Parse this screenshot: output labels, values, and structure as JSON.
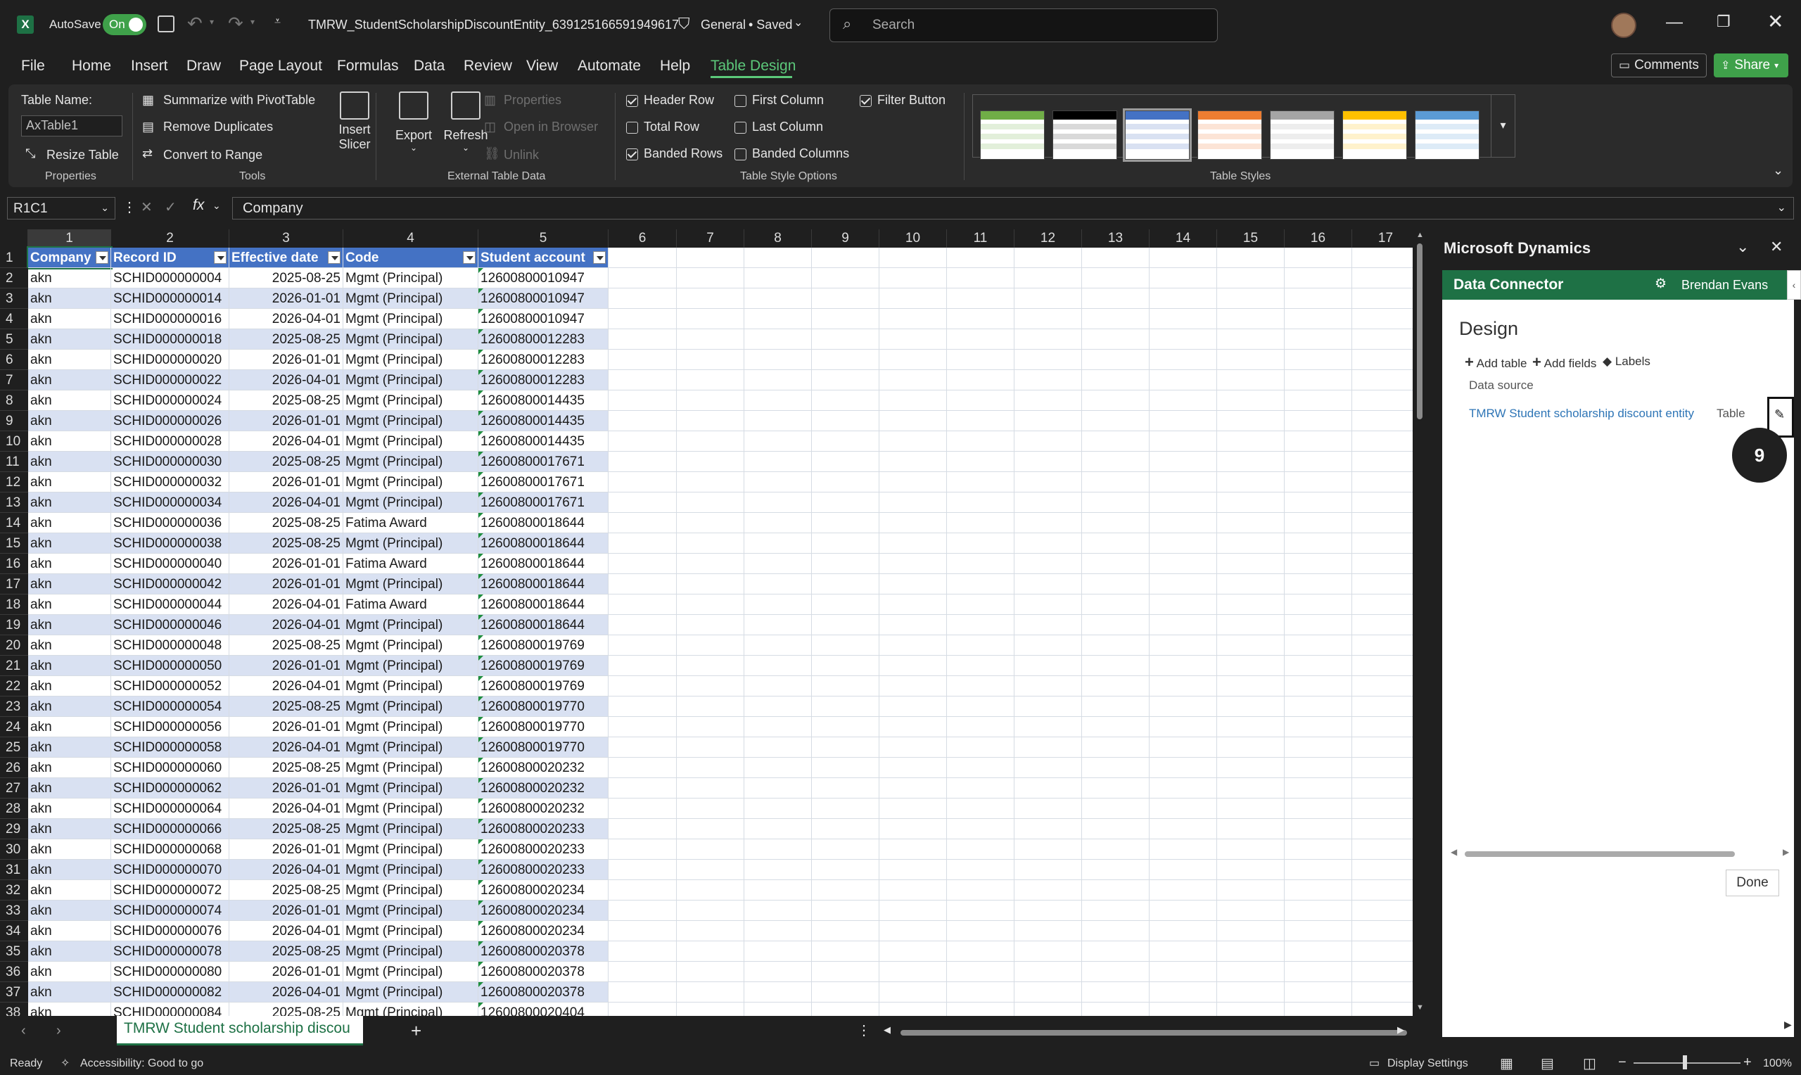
{
  "titlebar": {
    "autosave_label": "AutoSave",
    "autosave_state": "On",
    "file_name": "TMRW_StudentScholarshipDiscountEntity_639125166591949617",
    "sensitivity": "General",
    "save_state": "• Saved",
    "search_placeholder": "Search"
  },
  "menu": {
    "tabs": [
      "File",
      "Home",
      "Insert",
      "Draw",
      "Page Layout",
      "Formulas",
      "Data",
      "Review",
      "View",
      "Automate",
      "Help",
      "Table Design"
    ],
    "active": "Table Design",
    "comments": "Comments",
    "share": "Share"
  },
  "ribbon": {
    "properties": {
      "table_name_label": "Table Name:",
      "table_name_value": "AxTable1",
      "resize": "Resize Table",
      "group": "Properties"
    },
    "tools": {
      "pivot": "Summarize with PivotTable",
      "dupes": "Remove Duplicates",
      "convert": "Convert to Range",
      "slicer_1": "Insert",
      "slicer_2": "Slicer",
      "group": "Tools"
    },
    "external": {
      "export": "Export",
      "refresh": "Refresh",
      "props": "Properties",
      "browser": "Open in Browser",
      "unlink": "Unlink",
      "group": "External Table Data"
    },
    "options": {
      "header_row": "Header Row",
      "total_row": "Total Row",
      "banded_rows": "Banded Rows",
      "first_col": "First Column",
      "last_col": "Last Column",
      "banded_cols": "Banded Columns",
      "filter_btn": "Filter Button",
      "group": "Table Style Options"
    },
    "styles_group": "Table Styles"
  },
  "formula": {
    "namebox": "R1C1",
    "content": "Company"
  },
  "grid": {
    "col_headers": [
      "1",
      "2",
      "3",
      "4",
      "5",
      "6",
      "7",
      "8",
      "9",
      "10",
      "11",
      "12",
      "13",
      "14",
      "15",
      "16",
      "17"
    ],
    "table_headers": [
      "Company",
      "Record ID",
      "Effective date",
      "Code",
      "Student account"
    ],
    "rows": [
      [
        "akn",
        "SCHID000000004",
        "2025-08-25",
        "Mgmt (Principal)",
        "12600800010947"
      ],
      [
        "akn",
        "SCHID000000014",
        "2026-01-01",
        "Mgmt (Principal)",
        "12600800010947"
      ],
      [
        "akn",
        "SCHID000000016",
        "2026-04-01",
        "Mgmt (Principal)",
        "12600800010947"
      ],
      [
        "akn",
        "SCHID000000018",
        "2025-08-25",
        "Mgmt (Principal)",
        "12600800012283"
      ],
      [
        "akn",
        "SCHID000000020",
        "2026-01-01",
        "Mgmt (Principal)",
        "12600800012283"
      ],
      [
        "akn",
        "SCHID000000022",
        "2026-04-01",
        "Mgmt (Principal)",
        "12600800012283"
      ],
      [
        "akn",
        "SCHID000000024",
        "2025-08-25",
        "Mgmt (Principal)",
        "12600800014435"
      ],
      [
        "akn",
        "SCHID000000026",
        "2026-01-01",
        "Mgmt (Principal)",
        "12600800014435"
      ],
      [
        "akn",
        "SCHID000000028",
        "2026-04-01",
        "Mgmt (Principal)",
        "12600800014435"
      ],
      [
        "akn",
        "SCHID000000030",
        "2025-08-25",
        "Mgmt (Principal)",
        "12600800017671"
      ],
      [
        "akn",
        "SCHID000000032",
        "2026-01-01",
        "Mgmt (Principal)",
        "12600800017671"
      ],
      [
        "akn",
        "SCHID000000034",
        "2026-04-01",
        "Mgmt (Principal)",
        "12600800017671"
      ],
      [
        "akn",
        "SCHID000000036",
        "2025-08-25",
        "Fatima Award",
        "12600800018644"
      ],
      [
        "akn",
        "SCHID000000038",
        "2025-08-25",
        "Mgmt (Principal)",
        "12600800018644"
      ],
      [
        "akn",
        "SCHID000000040",
        "2026-01-01",
        "Fatima Award",
        "12600800018644"
      ],
      [
        "akn",
        "SCHID000000042",
        "2026-01-01",
        "Mgmt (Principal)",
        "12600800018644"
      ],
      [
        "akn",
        "SCHID000000044",
        "2026-04-01",
        "Fatima Award",
        "12600800018644"
      ],
      [
        "akn",
        "SCHID000000046",
        "2026-04-01",
        "Mgmt (Principal)",
        "12600800018644"
      ],
      [
        "akn",
        "SCHID000000048",
        "2025-08-25",
        "Mgmt (Principal)",
        "12600800019769"
      ],
      [
        "akn",
        "SCHID000000050",
        "2026-01-01",
        "Mgmt (Principal)",
        "12600800019769"
      ],
      [
        "akn",
        "SCHID000000052",
        "2026-04-01",
        "Mgmt (Principal)",
        "12600800019769"
      ],
      [
        "akn",
        "SCHID000000054",
        "2025-08-25",
        "Mgmt (Principal)",
        "12600800019770"
      ],
      [
        "akn",
        "SCHID000000056",
        "2026-01-01",
        "Mgmt (Principal)",
        "12600800019770"
      ],
      [
        "akn",
        "SCHID000000058",
        "2026-04-01",
        "Mgmt (Principal)",
        "12600800019770"
      ],
      [
        "akn",
        "SCHID000000060",
        "2025-08-25",
        "Mgmt (Principal)",
        "12600800020232"
      ],
      [
        "akn",
        "SCHID000000062",
        "2026-01-01",
        "Mgmt (Principal)",
        "12600800020232"
      ],
      [
        "akn",
        "SCHID000000064",
        "2026-04-01",
        "Mgmt (Principal)",
        "12600800020232"
      ],
      [
        "akn",
        "SCHID000000066",
        "2025-08-25",
        "Mgmt (Principal)",
        "12600800020233"
      ],
      [
        "akn",
        "SCHID000000068",
        "2026-01-01",
        "Mgmt (Principal)",
        "12600800020233"
      ],
      [
        "akn",
        "SCHID000000070",
        "2026-04-01",
        "Mgmt (Principal)",
        "12600800020233"
      ],
      [
        "akn",
        "SCHID000000072",
        "2025-08-25",
        "Mgmt (Principal)",
        "12600800020234"
      ],
      [
        "akn",
        "SCHID000000074",
        "2026-01-01",
        "Mgmt (Principal)",
        "12600800020234"
      ],
      [
        "akn",
        "SCHID000000076",
        "2026-04-01",
        "Mgmt (Principal)",
        "12600800020234"
      ],
      [
        "akn",
        "SCHID000000078",
        "2025-08-25",
        "Mgmt (Principal)",
        "12600800020378"
      ],
      [
        "akn",
        "SCHID000000080",
        "2026-01-01",
        "Mgmt (Principal)",
        "12600800020378"
      ],
      [
        "akn",
        "SCHID000000082",
        "2026-04-01",
        "Mgmt (Principal)",
        "12600800020378"
      ],
      [
        "akn",
        "SCHID000000084",
        "2025-08-25",
        "Mgmt (Principal)",
        "12600800020404"
      ]
    ]
  },
  "sheet": {
    "tab": "TMRW Student scholarship discou"
  },
  "status": {
    "ready": "Ready",
    "accessibility": "Accessibility: Good to go",
    "display": "Display Settings",
    "zoom": "100%"
  },
  "pane": {
    "title": "Microsoft Dynamics",
    "connector": "Data Connector",
    "user": "Brendan Evans",
    "design": "Design",
    "add_table": "Add table",
    "add_fields": "Add fields",
    "labels": "Labels",
    "data_source_label": "Data source",
    "source_name": "TMRW Student scholarship discount entity",
    "source_type": "Table",
    "badge": "9",
    "done": "Done"
  },
  "colors": {
    "accent_green": "#1e7145",
    "table_header": "#4472c4",
    "band": "#d9e1f2"
  }
}
